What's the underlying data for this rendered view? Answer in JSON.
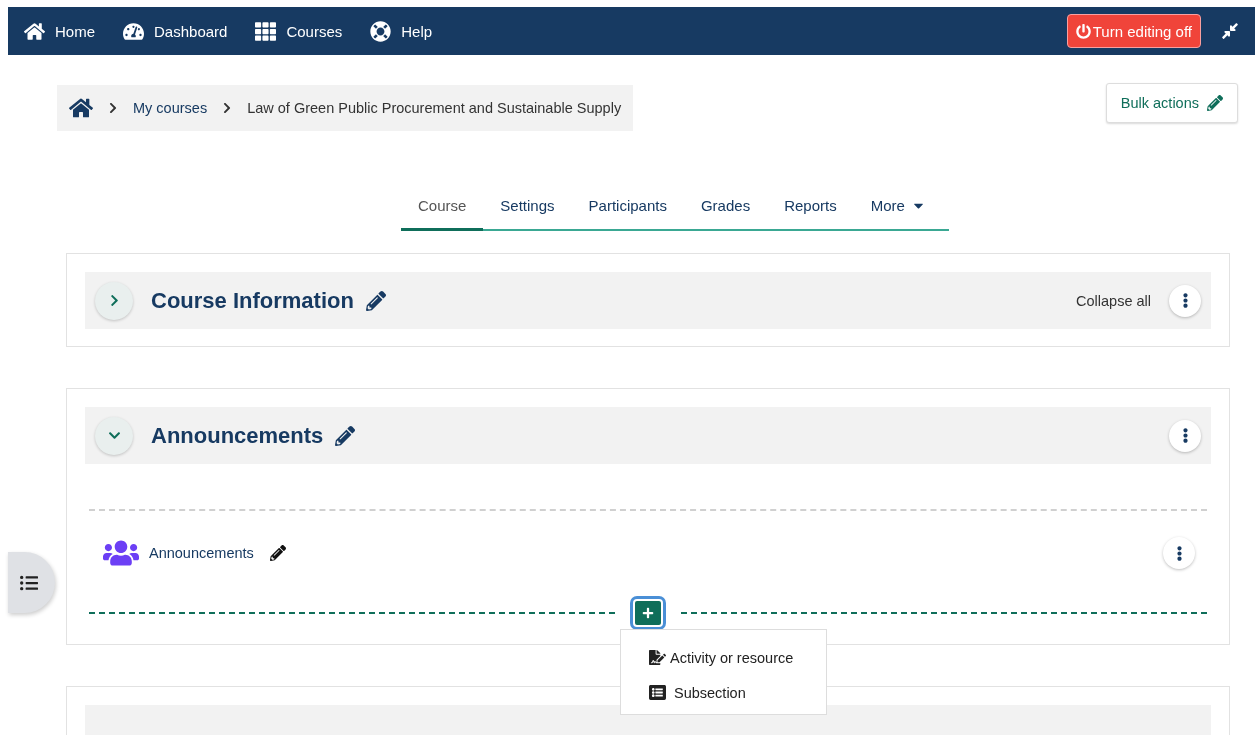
{
  "navbar": {
    "items": [
      {
        "label": "Home"
      },
      {
        "label": "Dashboard"
      },
      {
        "label": "Courses"
      },
      {
        "label": "Help"
      }
    ],
    "edit_button": {
      "label": "Turn editing off",
      "editing": true
    }
  },
  "breadcrumb": {
    "items": [
      {
        "label": "My courses"
      },
      {
        "label": "Law of Green Public Procurement and Sustainable Supply"
      }
    ]
  },
  "bulk_actions": {
    "label": "Bulk actions"
  },
  "tabs": [
    {
      "label": "Course",
      "selected": true
    },
    {
      "label": "Settings",
      "selected": false
    },
    {
      "label": "Participants",
      "selected": false
    },
    {
      "label": "Grades",
      "selected": false
    },
    {
      "label": "Reports",
      "selected": false
    },
    {
      "label": "More",
      "selected": false,
      "dropdown": true
    }
  ],
  "sections": [
    {
      "title": "Course Information",
      "expanded": false,
      "collapse_all_label": "Collapse all"
    },
    {
      "title": "Announcements",
      "expanded": true,
      "activities": [
        {
          "name": "Announcements"
        }
      ],
      "add_menu": {
        "open": true,
        "items": [
          {
            "label": "Activity or resource"
          },
          {
            "label": "Subsection"
          }
        ]
      }
    }
  ]
}
